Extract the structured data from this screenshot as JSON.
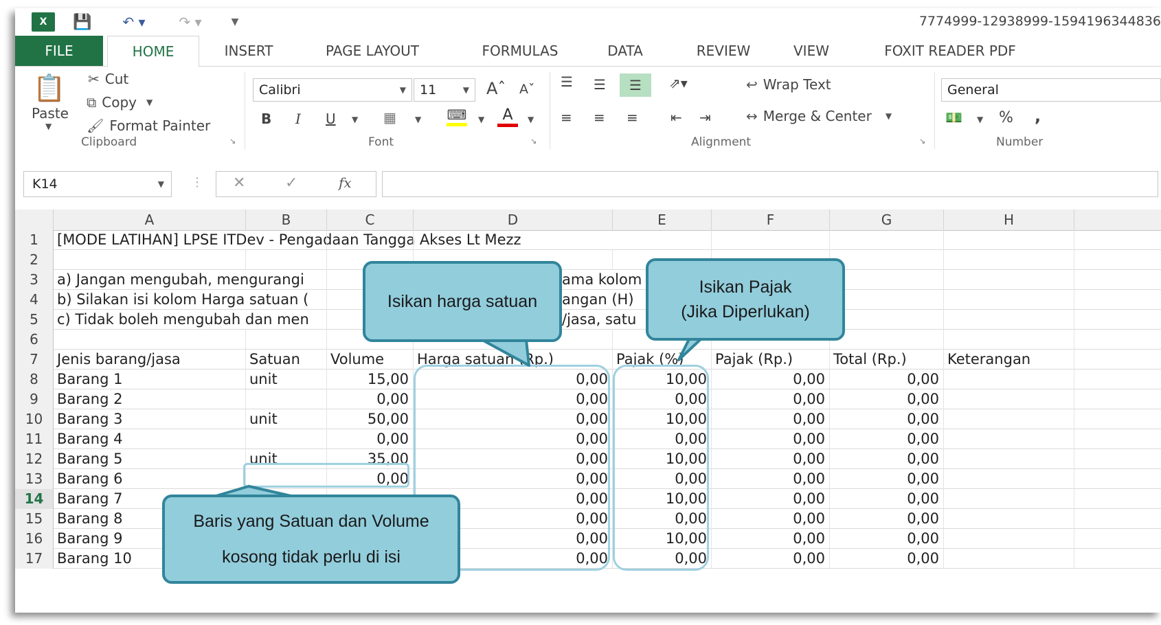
{
  "qat": {
    "app_icon": "excel-icon",
    "title": "7774999-12938999-1594196344836"
  },
  "tabs": [
    "FILE",
    "HOME",
    "INSERT",
    "PAGE LAYOUT",
    "FORMULAS",
    "DATA",
    "REVIEW",
    "VIEW",
    "FOXIT READER PDF"
  ],
  "clipboard": {
    "paste": "Paste",
    "cut": "Cut",
    "copy": "Copy",
    "format_painter": "Format Painter",
    "label": "Clipboard"
  },
  "font": {
    "name": "Calibri",
    "size": "11",
    "label": "Font",
    "bold": "B",
    "italic": "I",
    "underline": "U"
  },
  "alignment": {
    "wrap": "Wrap Text",
    "merge": "Merge & Center",
    "label": "Alignment"
  },
  "number": {
    "format": "General",
    "percent": "%",
    "comma": ",",
    "label": "Number"
  },
  "formula_bar": {
    "name_box": "K14",
    "fx": "fx",
    "value": ""
  },
  "columns": [
    "A",
    "B",
    "C",
    "D",
    "E",
    "F",
    "G",
    "H"
  ],
  "rows": [
    {
      "n": "1",
      "a": "[MODE LATIHAN] LPSE ITDev  - Pengadaan Tangga Akses Lt Mezz",
      "b": "",
      "c": "",
      "d": "",
      "e": "",
      "f": "",
      "g": "",
      "h": ""
    },
    {
      "n": "2",
      "a": "",
      "b": "",
      "c": "",
      "d": "",
      "e": "",
      "f": "",
      "g": "",
      "h": ""
    },
    {
      "n": "3",
      "a": "a) Jangan mengubah, mengurangi",
      "b": "",
      "c": "",
      "d": "ama kolom",
      "e": "",
      "f": "",
      "g": "",
      "h": ""
    },
    {
      "n": "4",
      "a": "b) Silakan isi kolom Harga satuan (",
      "b": "",
      "c": "",
      "d": "angan (H)",
      "e": "",
      "f": "",
      "g": "",
      "h": ""
    },
    {
      "n": "5",
      "a": "c) Tidak boleh mengubah dan men",
      "b": "",
      "c": "",
      "d": "/jasa, satu",
      "e": "",
      "f": "",
      "g": "",
      "h": ""
    },
    {
      "n": "6",
      "a": "",
      "b": "",
      "c": "",
      "d": "",
      "e": "",
      "f": "",
      "g": "",
      "h": ""
    },
    {
      "n": "7",
      "a": "Jenis barang/jasa",
      "b": "Satuan",
      "c": "Volume",
      "d": "Harga satuan (Rp.)",
      "e": "Pajak (%)",
      "f": "Pajak (Rp.)",
      "g": "Total (Rp.)",
      "h": "Keterangan"
    },
    {
      "n": "8",
      "a": "Barang 1",
      "b": "unit",
      "c": "15,00",
      "d": "0,00",
      "e": "10,00",
      "f": "0,00",
      "g": "0,00",
      "h": ""
    },
    {
      "n": "9",
      "a": "Barang 2",
      "b": "",
      "c": "0,00",
      "d": "0,00",
      "e": "0,00",
      "f": "0,00",
      "g": "0,00",
      "h": ""
    },
    {
      "n": "10",
      "a": "Barang 3",
      "b": "unit",
      "c": "50,00",
      "d": "0,00",
      "e": "10,00",
      "f": "0,00",
      "g": "0,00",
      "h": ""
    },
    {
      "n": "11",
      "a": "Barang 4",
      "b": "",
      "c": "0,00",
      "d": "0,00",
      "e": "0,00",
      "f": "0,00",
      "g": "0,00",
      "h": ""
    },
    {
      "n": "12",
      "a": "Barang 5",
      "b": "unit",
      "c": "35,00",
      "d": "0,00",
      "e": "10,00",
      "f": "0,00",
      "g": "0,00",
      "h": ""
    },
    {
      "n": "13",
      "a": "Barang 6",
      "b": "",
      "c": "0,00",
      "d": "0,00",
      "e": "0,00",
      "f": "0,00",
      "g": "0,00",
      "h": ""
    },
    {
      "n": "14",
      "a": "Barang 7",
      "b": "",
      "c": "",
      "d": "0,00",
      "e": "10,00",
      "f": "0,00",
      "g": "0,00",
      "h": ""
    },
    {
      "n": "15",
      "a": "Barang 8",
      "b": "",
      "c": "",
      "d": "0,00",
      "e": "0,00",
      "f": "0,00",
      "g": "0,00",
      "h": ""
    },
    {
      "n": "16",
      "a": "Barang 9",
      "b": "",
      "c": "",
      "d": "0,00",
      "e": "10,00",
      "f": "0,00",
      "g": "0,00",
      "h": ""
    },
    {
      "n": "17",
      "a": "Barang 10",
      "b": "",
      "c": "",
      "d": "0,00",
      "e": "0,00",
      "f": "0,00",
      "g": "0,00",
      "h": ""
    }
  ],
  "callouts": {
    "harga": "Isikan harga satuan",
    "pajak_line1": "Isikan Pajak",
    "pajak_line2": "(Jika Diperlukan)",
    "baris_line1": "Baris yang Satuan dan Volume",
    "baris_line2": "kosong tidak perlu di isi"
  },
  "colors": {
    "excel_green": "#217346",
    "callout_fill": "#92cddc",
    "callout_border": "#31859b",
    "highlight": "#9fd0e0"
  }
}
